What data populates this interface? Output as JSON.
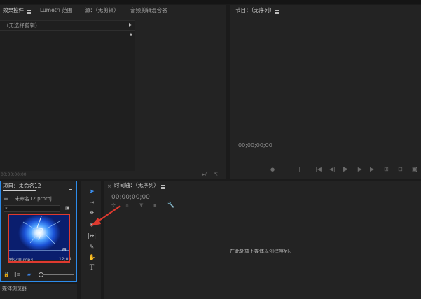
{
  "top_tabs": {
    "effect_controls": "效果控件",
    "lumetri_scopes": "Lumetri 范围",
    "source": "源：（无剪辑）",
    "audio_mixer": "音频剪辑混合器"
  },
  "source_panel": {
    "dropdown": "（无选择剪辑）",
    "timecode": "00;00;00;00"
  },
  "program_panel": {
    "title": "节目：（无序列）",
    "timecode": "00;00;00;00"
  },
  "project_panel": {
    "title": "项目：未命名12",
    "project_file": "未命名12.prproj",
    "clip_name": "烈火III.mp4",
    "clip_duration": "12;06",
    "effects_browser": "媒体浏览器"
  },
  "timeline_panel": {
    "title": "时间轴：（无序列）",
    "timecode": "00;00;00;00",
    "empty_message": "在此处放下媒体以创建序列。"
  },
  "colors": {
    "annotation_red": "#e03a2f",
    "selection_blue": "#2d8ceb",
    "panel_bg": "#232323",
    "app_bg": "#1b1b1b"
  },
  "icons": {
    "toolbar": [
      "selection-tool-icon",
      "track-select-icon",
      "ripple-edit-icon",
      "razor-tool-icon",
      "slip-tool-icon",
      "pen-tool-icon",
      "hand-tool-icon",
      "type-tool-icon"
    ],
    "transport": [
      "marker-icon",
      "in-point-icon",
      "out-point-icon",
      "go-to-in-icon",
      "step-back-icon",
      "play-icon",
      "step-forward-icon",
      "go-to-out-icon",
      "insert-icon",
      "overwrite-icon",
      "export-frame-icon"
    ]
  }
}
